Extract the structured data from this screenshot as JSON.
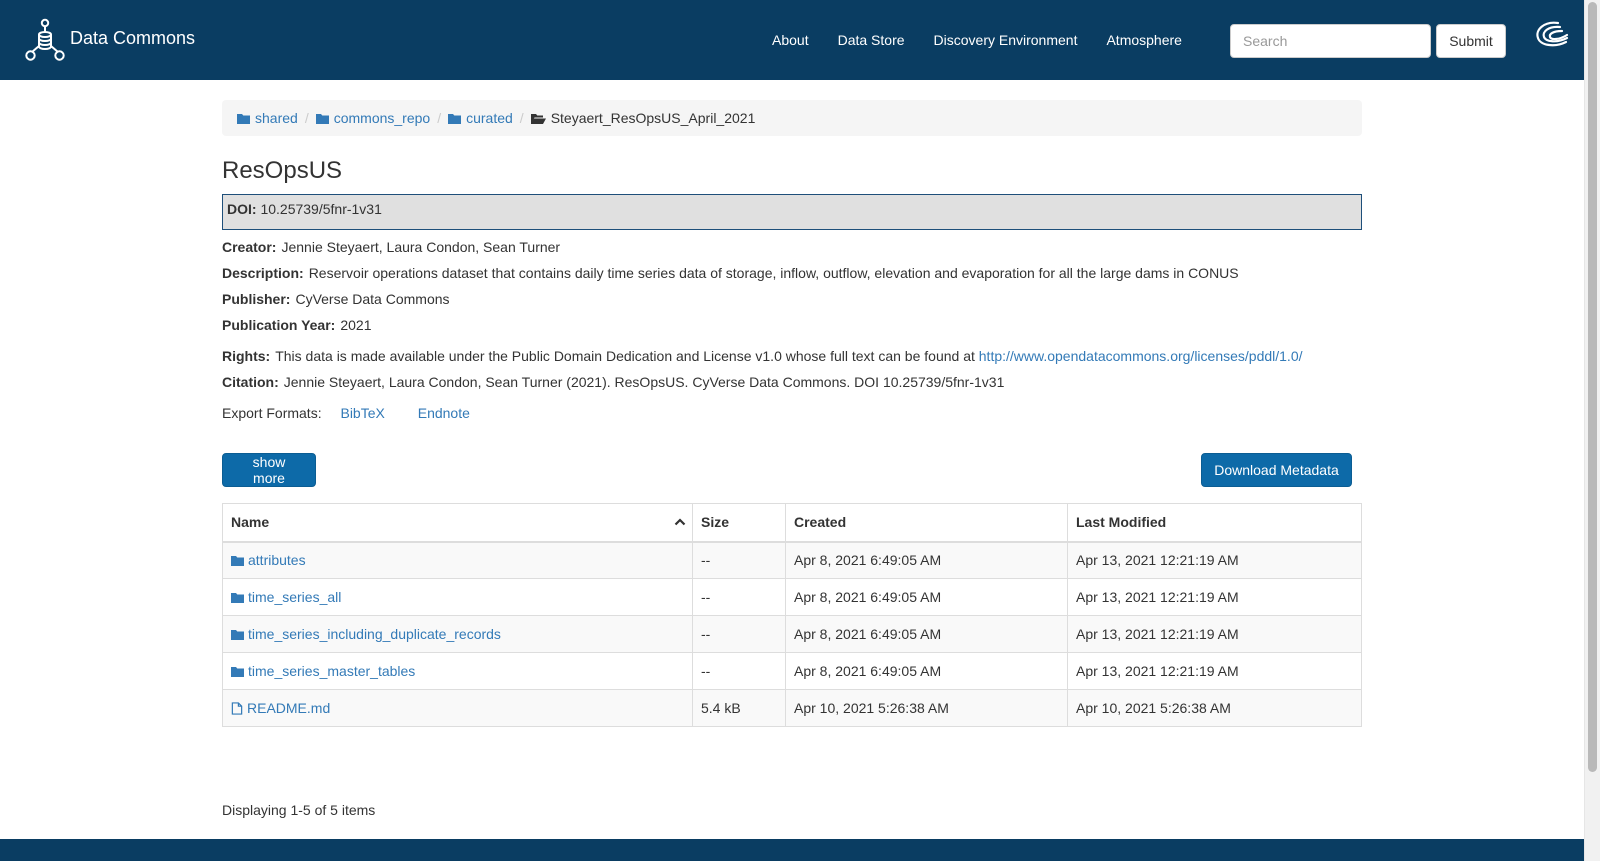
{
  "brand": {
    "name": "Data Commons"
  },
  "nav": {
    "links": [
      "About",
      "Data Store",
      "Discovery Environment",
      "Atmosphere"
    ],
    "search_placeholder": "Search",
    "submit_label": "Submit"
  },
  "breadcrumb": [
    "shared",
    "commons_repo",
    "curated",
    "Steyaert_ResOpsUS_April_2021"
  ],
  "dataset": {
    "title": "ResOpsUS",
    "doi_label": "DOI:",
    "doi": "10.25739/5fnr-1v31",
    "creator_label": "Creator:",
    "creator": "Jennie Steyaert, Laura Condon, Sean Turner",
    "description_label": "Description:",
    "description": "Reservoir operations dataset that contains daily time series data of storage, inflow, outflow, elevation and evaporation for all the large dams in CONUS",
    "publisher_label": "Publisher:",
    "publisher": "CyVerse Data Commons",
    "pubyear_label": "Publication Year:",
    "pubyear": "2021",
    "rights_label": "Rights:",
    "rights": "This data is made available under the Public Domain Dedication and License v1.0 whose full text can be found at",
    "rights_link": "http://www.opendatacommons.org/licenses/pddl/1.0/",
    "citation_label": "Citation:",
    "citation": "Jennie Steyaert, Laura Condon, Sean Turner (2021). ResOpsUS. CyVerse Data Commons. DOI 10.25739/5fnr-1v31",
    "export_label": "Export Formats:",
    "export_formats": [
      "BibTeX",
      "Endnote"
    ]
  },
  "buttons": {
    "show_more": "show more",
    "download_metadata": "Download Metadata"
  },
  "table": {
    "headers": [
      "Name",
      "Size",
      "Created",
      "Last Modified"
    ],
    "rows": [
      {
        "icon": "folder-icon",
        "name": "attributes",
        "size": "--",
        "created": "Apr 8, 2021 6:49:05 AM",
        "modified": "Apr 13, 2021 12:21:19 AM"
      },
      {
        "icon": "folder-icon",
        "name": "time_series_all",
        "size": "--",
        "created": "Apr 8, 2021 6:49:05 AM",
        "modified": "Apr 13, 2021 12:21:19 AM"
      },
      {
        "icon": "folder-icon",
        "name": "time_series_including_duplicate_records",
        "size": "--",
        "created": "Apr 8, 2021 6:49:05 AM",
        "modified": "Apr 13, 2021 12:21:19 AM"
      },
      {
        "icon": "folder-icon",
        "name": "time_series_master_tables",
        "size": "--",
        "created": "Apr 8, 2021 6:49:05 AM",
        "modified": "Apr 13, 2021 12:21:19 AM"
      },
      {
        "icon": "file-icon",
        "name": "README.md",
        "size": "5.4 kB",
        "created": "Apr 10, 2021 5:26:38 AM",
        "modified": "Apr 10, 2021 5:26:38 AM"
      }
    ]
  },
  "pagination": {
    "text": "Displaying 1-5 of 5 items"
  },
  "colors": {
    "navbar": "#0a3d62",
    "link": "#337ab7",
    "primary_button": "#0d6aa8"
  }
}
